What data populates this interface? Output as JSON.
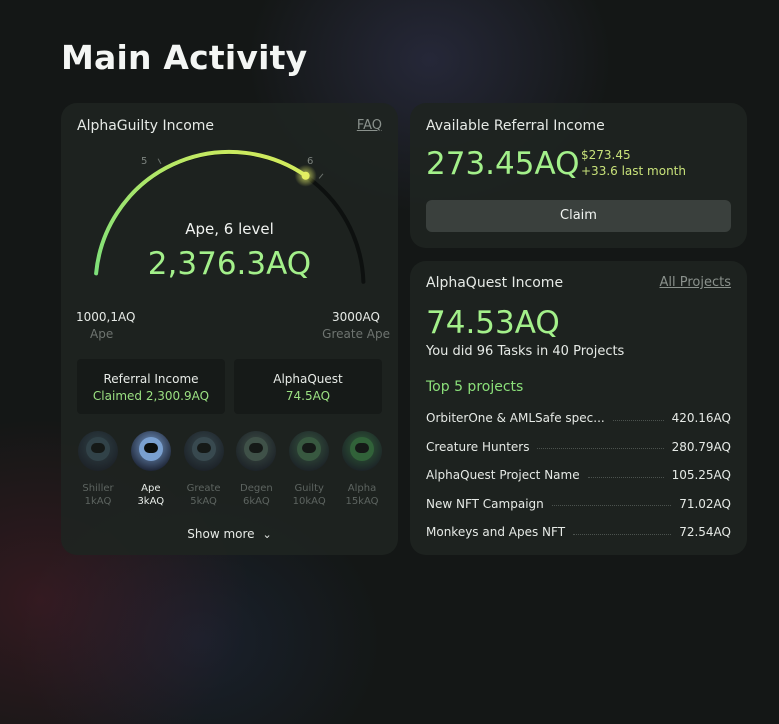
{
  "page": {
    "title": "Main Activity"
  },
  "alpha": {
    "title": "AlphaGuilty Income",
    "faq": "FAQ",
    "gauge": {
      "progress": 0.69,
      "level": "Ape, 6 level",
      "value": "2,376.3AQ",
      "min_value": "1000,1AQ",
      "min_label": "Ape",
      "max_value": "3000AQ",
      "max_label": "Greate Ape",
      "tick_left": "5",
      "tick_right": "6"
    },
    "referral_box": {
      "title": "Referral Income",
      "value": "Claimed 2,300.9AQ"
    },
    "quest_box": {
      "title": "AlphaQuest",
      "value": "74.5AQ"
    },
    "levels": [
      {
        "name": "Shiller",
        "price": "1kAQ",
        "color": "#4a6a7a",
        "active": false
      },
      {
        "name": "Ape",
        "price": "3kAQ",
        "color": "#7aa0d0",
        "active": true
      },
      {
        "name": "Greate",
        "price": "5kAQ",
        "color": "#5a7a8a",
        "active": false
      },
      {
        "name": "Degen",
        "price": "6kAQ",
        "color": "#6a8a7a",
        "active": false
      },
      {
        "name": "Guilty",
        "price": "10kAQ",
        "color": "#5a9a6a",
        "active": false
      },
      {
        "name": "Alpha",
        "price": "15kAQ",
        "color": "#4ab05a",
        "active": false
      }
    ],
    "show_more": "Show more"
  },
  "referral": {
    "title": "Available Referral Income",
    "value": "273.45AQ",
    "usd": "$273.45",
    "delta": "+33.6 last month",
    "claim": "Claim"
  },
  "quest": {
    "title": "AlphaQuest Income",
    "all_projects": "All Projects",
    "value": "74.53AQ",
    "subtitle": "You did 96 Tasks in 40 Projects",
    "top_title": "Top 5 projects",
    "projects": [
      {
        "name": "OrbiterOne & AMLSafe spec...",
        "value": "420.16AQ"
      },
      {
        "name": "Creature Hunters",
        "value": "280.79AQ"
      },
      {
        "name": "AlphaQuest Project Name",
        "value": "105.25AQ"
      },
      {
        "name": "New NFT Campaign",
        "value": "71.02AQ"
      },
      {
        "name": "Monkeys and Apes NFT",
        "value": "72.54AQ"
      }
    ]
  },
  "colors": {
    "accent_green": "#a3f08a",
    "accent_yellow": "#d7e85a",
    "card_bg": "#1e2421"
  }
}
